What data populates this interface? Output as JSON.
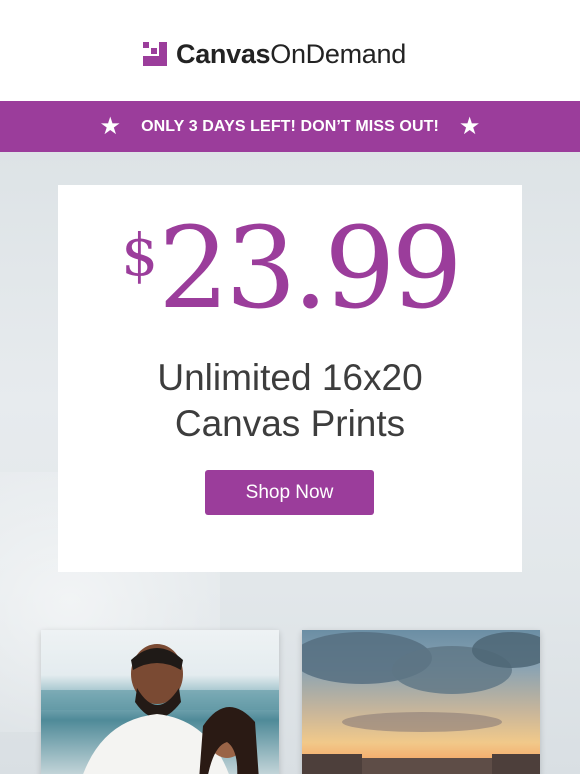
{
  "header": {
    "brand_bold": "Canvas",
    "brand_regular": "OnDemand",
    "logo_color": "#9b3d9b"
  },
  "banner": {
    "text": "ONLY 3 DAYS LEFT! DON’T MISS OUT!",
    "star_left": "★",
    "star_right": "★",
    "background": "#9b3d9b"
  },
  "promo": {
    "currency": "$",
    "amount": "23.99",
    "line1": "Unlimited 16x20",
    "line2": "Canvas Prints",
    "cta_label": "Shop Now"
  },
  "photos": [
    {
      "subject": "couple-on-beach"
    },
    {
      "subject": "sunset-sky"
    }
  ]
}
